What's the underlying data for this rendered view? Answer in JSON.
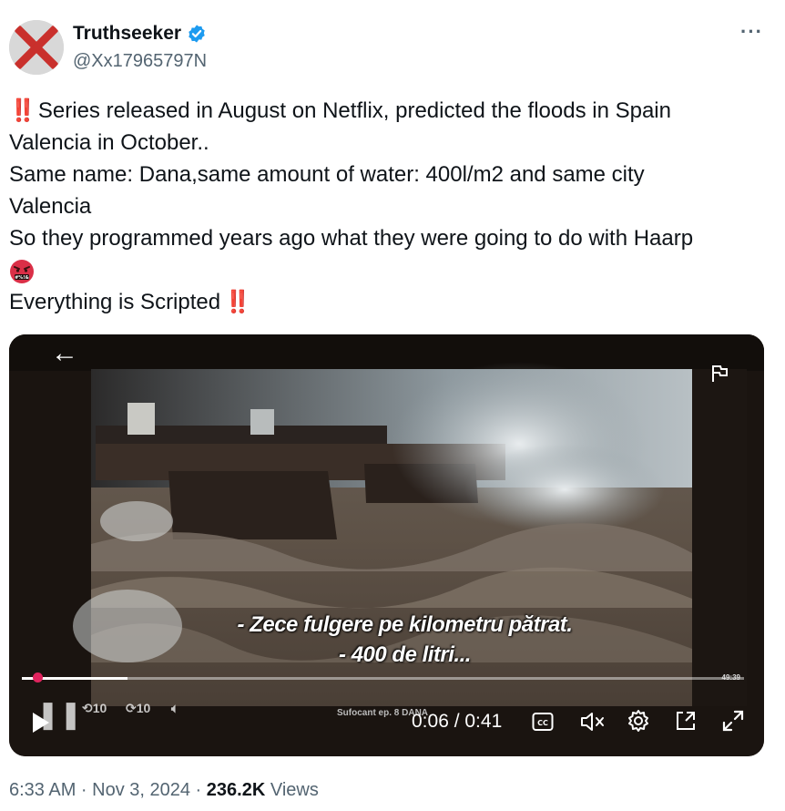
{
  "author": {
    "display_name": "Truthseeker",
    "handle": "@Xx17965797N",
    "verified": true,
    "verified_color": "#1d9bf0"
  },
  "more_label": "···",
  "tweet": {
    "line1_bang": "‼️",
    "line1": "Series released in August on Netflix, predicted the floods in Spain",
    "line2": "Valencia in October..",
    "line3": "Same name: Dana,same amount of water: 400l/m2 and same city",
    "line4": "Valencia",
    "line5": "So they programmed years ago what they were going to do with Haarp",
    "line6_emoji": "face-with-symbols-on-mouth",
    "line7": "Everything is Scripted",
    "line7_bang": "‼️"
  },
  "video": {
    "subtitle_line1": "- Zece fulgere pe kilometru pătrat.",
    "subtitle_line2": "- 400 de litri...",
    "watermark": "Sufocant ep. 8  DANA",
    "small_duration": "49:39",
    "current_time": "0:06 / 0:41",
    "progress": 0.146,
    "cc_label": "CC",
    "icons": [
      "back-arrow-icon",
      "flag-icon",
      "play-icon",
      "cc-icon",
      "mute-icon",
      "settings-icon",
      "pip-icon",
      "fullscreen-icon"
    ]
  },
  "footer": {
    "time_date": "6:33 AM · Nov 3, 2024 · ",
    "views_count": "236.2K",
    "views_label": " Views"
  },
  "colors": {
    "accent": "#1d9bf0",
    "bang": "#e0245e",
    "secondary_text": "#536471"
  }
}
